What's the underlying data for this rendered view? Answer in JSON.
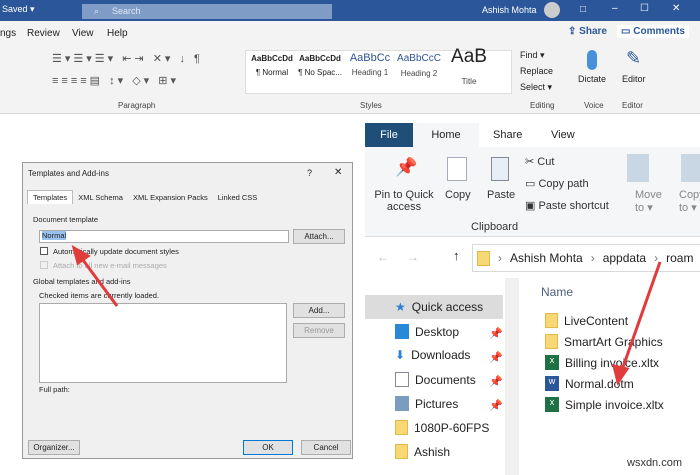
{
  "word": {
    "title_left": "Saved ▾",
    "search_placeholder": "Search",
    "user": "Ashish Mohta",
    "window_controls": [
      "□",
      "–",
      "☐",
      "✕"
    ],
    "menu": [
      "ngs",
      "Review",
      "View",
      "Help"
    ],
    "share": "Share",
    "comments": "Comments",
    "styles": [
      {
        "sample": "AaBbCcDd",
        "label": "¶ Normal"
      },
      {
        "sample": "AaBbCcDd",
        "label": "¶ No Spac..."
      },
      {
        "sample": "AaBbCc",
        "label": "Heading 1"
      },
      {
        "sample": "AaBbCcC",
        "label": "Heading 2"
      },
      {
        "sample": "AaB",
        "label": "Title"
      }
    ],
    "editing": {
      "find": "Find ▾",
      "replace": "Replace",
      "select": "Select ▾"
    },
    "dictate": "Dictate",
    "editor": "Editor",
    "groups": {
      "paragraph": "Paragraph",
      "styles": "Styles",
      "editing": "Editing",
      "voice": "Voice",
      "editor": "Editor"
    }
  },
  "dialog": {
    "title": "Templates and Add-ins",
    "help": "?",
    "close": "✕",
    "tabs": [
      "Templates",
      "XML Schema",
      "XML Expansion Packs",
      "Linked CSS"
    ],
    "doc_template_label": "Document template",
    "template_value": "Normal",
    "attach": "Attach...",
    "auto_update": "Automatically update document styles",
    "attach_email": "Attach to all new e-mail messages",
    "global_label": "Global templates and add-ins",
    "checked_note": "Checked items are currently loaded.",
    "add": "Add...",
    "remove": "Remove",
    "full_path": "Full path:",
    "organizer": "Organizer...",
    "ok": "OK",
    "cancel": "Cancel"
  },
  "explorer": {
    "tabs": [
      "File",
      "Home",
      "Share",
      "View"
    ],
    "pin": "Pin to Quick access",
    "copy": "Copy",
    "paste": "Paste",
    "cut": "Cut",
    "copy_path": "Copy path",
    "paste_shortcut": "Paste shortcut",
    "clipboard": "Clipboard",
    "move_to": "Move to ▾",
    "copy_to": "Copy to ▾",
    "path": [
      "Ashish Mohta",
      "appdata",
      "roam"
    ],
    "column": "Name",
    "nav": [
      {
        "label": "Quick access",
        "icon": "star-icon"
      },
      {
        "label": "Desktop",
        "icon": "desktop-icon",
        "pinned": true
      },
      {
        "label": "Downloads",
        "icon": "download-icon",
        "pinned": true
      },
      {
        "label": "Documents",
        "icon": "document-icon",
        "pinned": true
      },
      {
        "label": "Pictures",
        "icon": "picture-icon",
        "pinned": true
      },
      {
        "label": "1080P-60FPS",
        "icon": "folder-icon"
      },
      {
        "label": "Ashish",
        "icon": "folder-icon"
      }
    ],
    "files": [
      {
        "name": "LiveContent",
        "type": "folder"
      },
      {
        "name": "SmartArt Graphics",
        "type": "folder"
      },
      {
        "name": "Billing invoice.xltx",
        "type": "excel"
      },
      {
        "name": "Normal.dotm",
        "type": "word"
      },
      {
        "name": "Simple invoice.xltx",
        "type": "excel"
      }
    ]
  },
  "watermark": "wsxdn.com",
  "colors": {
    "word_blue": "#2b579a",
    "file_tab": "#1f4e79",
    "arrow": "#e03c3c",
    "excel": "#1e7145",
    "word": "#2b579a"
  }
}
